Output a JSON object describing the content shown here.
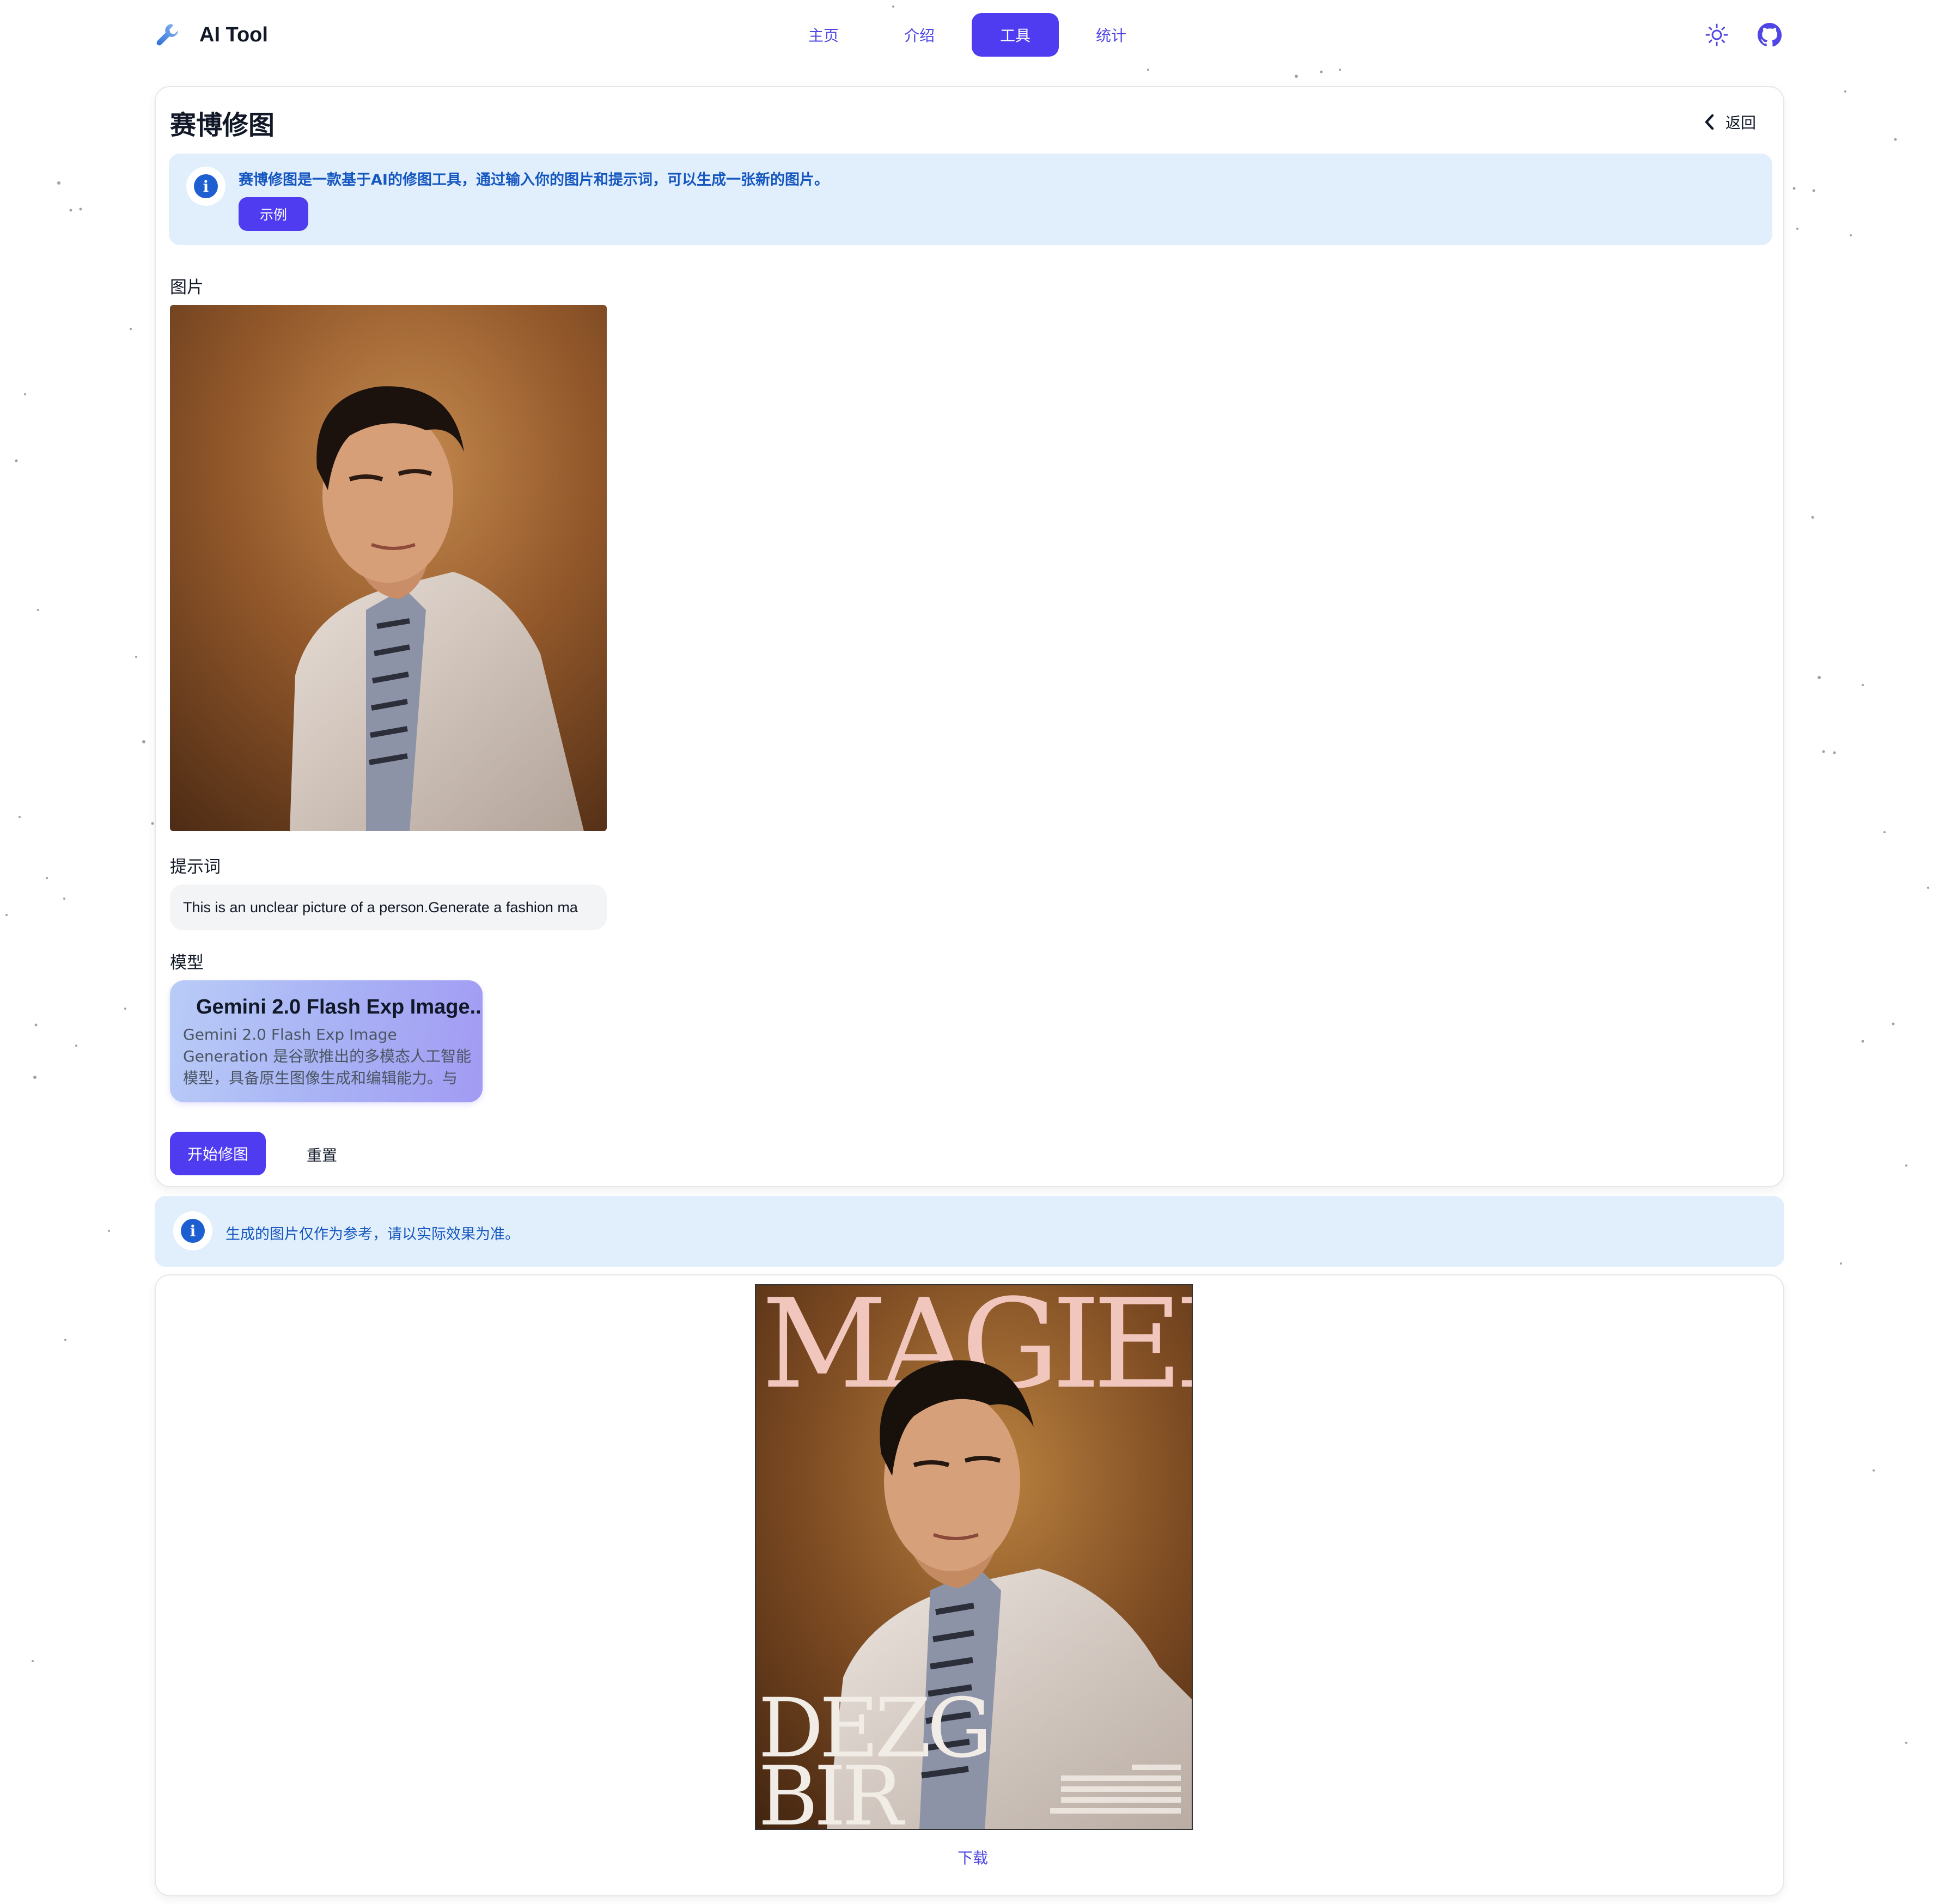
{
  "app": {
    "name": "AI Tool"
  },
  "nav": {
    "links": [
      {
        "label": "主页",
        "active": false
      },
      {
        "label": "介绍",
        "active": false
      },
      {
        "label": "工具",
        "active": true
      },
      {
        "label": "统计",
        "active": false
      }
    ],
    "icons": [
      "sun-icon",
      "github-icon"
    ]
  },
  "tool": {
    "title": "赛博修图",
    "back_label": "返回",
    "intro_text": "赛博修图是一款基于AI的修图工具，通过输入你的图片和提示词，可以生成一张新的图片。",
    "example_button": "示例",
    "image_label": "图片",
    "prompt_label": "提示词",
    "prompt_value": "This is an unclear picture of a person.Generate a fashion ma",
    "model_label": "模型",
    "model": {
      "name": "Gemini 2.0 Flash Exp Image..",
      "description": "Gemini 2.0 Flash Exp Image Generation 是谷歌推出的多模态人工智能模型，具备原生图像生成和编辑能力。与其他图像..."
    },
    "start_button": "开始修图",
    "reset_button": "重置"
  },
  "notice": {
    "text": "生成的图片仅作为参考，请以实际效果为准。"
  },
  "result": {
    "magazine_title": "MAGIER",
    "magazine_sub_1": "DEZG",
    "magazine_sub_2": "BIR",
    "download_label": "下载"
  },
  "colors": {
    "accent": "#4f3cf0",
    "alert_bg": "#e1eefb",
    "info_blue": "#1d5fd0"
  }
}
